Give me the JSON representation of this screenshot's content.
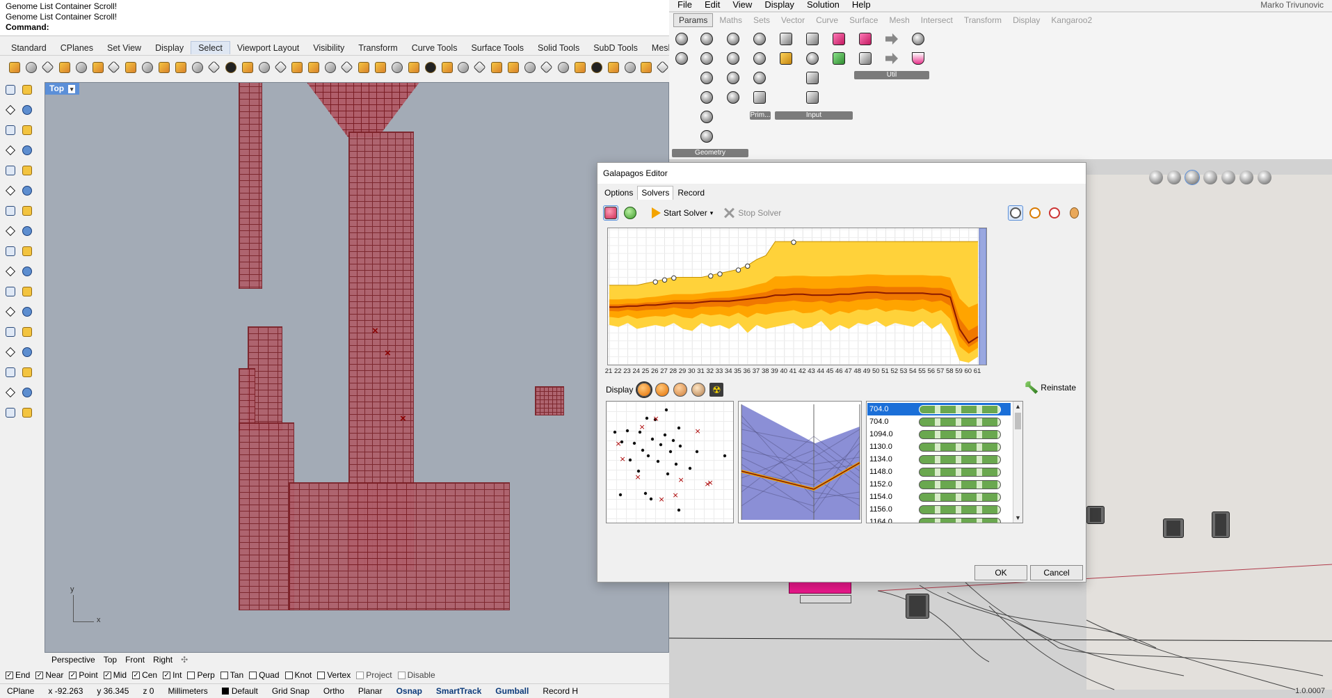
{
  "rhino": {
    "command_history": [
      "Genome List Container Scroll!",
      "Genome List Container Scroll!"
    ],
    "command_prompt": "Command:",
    "tabs": [
      "Standard",
      "CPlanes",
      "Set View",
      "Display",
      "Select",
      "Viewport Layout",
      "Visibility",
      "Transform",
      "Curve Tools",
      "Surface Tools",
      "Solid Tools",
      "SubD Tools",
      "Mesh Tools"
    ],
    "active_tab": "Select",
    "viewport_label": "Top",
    "viewport_tabs": [
      "Perspective",
      "Top",
      "Front",
      "Right"
    ],
    "axis_labels": {
      "y": "y",
      "x": "x"
    },
    "osnaps": [
      {
        "label": "End",
        "checked": true
      },
      {
        "label": "Near",
        "checked": true
      },
      {
        "label": "Point",
        "checked": true
      },
      {
        "label": "Mid",
        "checked": true
      },
      {
        "label": "Cen",
        "checked": true
      },
      {
        "label": "Int",
        "checked": true
      },
      {
        "label": "Perp",
        "checked": false
      },
      {
        "label": "Tan",
        "checked": false
      },
      {
        "label": "Quad",
        "checked": false
      },
      {
        "label": "Knot",
        "checked": false
      },
      {
        "label": "Vertex",
        "checked": false
      },
      {
        "label": "Project",
        "checked": false
      },
      {
        "label": "Disable",
        "checked": false
      }
    ],
    "status": {
      "cplane": "CPlane",
      "x": "x -92.263",
      "y": "y 36.345",
      "z": "z 0",
      "units": "Millimeters",
      "layer": "Default",
      "grid_snap": "Grid Snap",
      "ortho": "Ortho",
      "planar": "Planar",
      "osnap": "Osnap",
      "smarttrack": "SmartTrack",
      "gumball": "Gumball",
      "record": "Record H"
    }
  },
  "grasshopper": {
    "menu": [
      "File",
      "Edit",
      "View",
      "Display",
      "Solution",
      "Help"
    ],
    "user": "Marko Trivunovic",
    "tabs": [
      "Params",
      "Maths",
      "Sets",
      "Vector",
      "Curve",
      "Surface",
      "Mesh",
      "Intersect",
      "Transform",
      "Display",
      "Kangaroo2"
    ],
    "active_tab": "Params",
    "groups": [
      "Geometry",
      "Prim...",
      "Input",
      "Util"
    ],
    "zoom": "1.0.0007"
  },
  "galapagos": {
    "title": "Galapagos Editor",
    "tabs": [
      "Options",
      "Solvers",
      "Record"
    ],
    "active_tab": "Solvers",
    "start_solver": "Start Solver",
    "stop_solver": "Stop Solver",
    "display_label": "Display",
    "reinstate": "Reinstate",
    "ok": "OK",
    "cancel": "Cancel",
    "genomes": [
      "704.0",
      "704.0",
      "1094.0",
      "1130.0",
      "1134.0",
      "1148.0",
      "1152.0",
      "1154.0",
      "1156.0",
      "1164.0"
    ],
    "selected_genome": 0,
    "colors": {
      "band_outer": "#ffd23a",
      "band_mid": "#ffa400",
      "band_inner": "#f07800",
      "mean_line": "#8a1a00",
      "selected_row": "#1b6fd8"
    }
  },
  "chart_data": {
    "type": "area",
    "title": "",
    "xlabel": "",
    "ylabel": "",
    "x": [
      21,
      22,
      23,
      24,
      25,
      26,
      27,
      28,
      29,
      30,
      31,
      32,
      33,
      34,
      35,
      36,
      37,
      38,
      39,
      40,
      41,
      42,
      43,
      44,
      45,
      46,
      47,
      48,
      49,
      50,
      51,
      52,
      53,
      54,
      55,
      56,
      57,
      58,
      59,
      60,
      61
    ],
    "series": [
      {
        "values": [
          40,
          40,
          40,
          40,
          41,
          42,
          43,
          44,
          44,
          44,
          44,
          45,
          46,
          47,
          48,
          50,
          53,
          55,
          62,
          62,
          62,
          62,
          62,
          62,
          62,
          62,
          62,
          62,
          62,
          62,
          62,
          62,
          62,
          62,
          62,
          62,
          62,
          62,
          62,
          62,
          62
        ]
      },
      {
        "values": [
          29,
          29,
          29.5,
          29.5,
          30,
          30,
          30.5,
          31,
          31,
          31,
          31.5,
          32,
          32,
          32,
          32.5,
          33,
          33.5,
          34,
          35,
          35,
          35.5,
          35.5,
          35,
          35,
          35,
          35.5,
          35.5,
          36,
          36.5,
          36.5,
          36,
          36,
          36,
          36,
          36,
          35.5,
          35.5,
          34,
          18,
          11,
          14
        ]
      },
      {
        "values": [
          20,
          19,
          21,
          18,
          19,
          20,
          19,
          21,
          18,
          17,
          21,
          19,
          20,
          18,
          21,
          16,
          20,
          18,
          19,
          20,
          21,
          18,
          19,
          22,
          17,
          20,
          18,
          21,
          20,
          22,
          19,
          21,
          20,
          19,
          22,
          18,
          21,
          14,
          2,
          1,
          4
        ]
      }
    ],
    "milestones": [
      26,
      27,
      28,
      32,
      33,
      35,
      36,
      41
    ],
    "ylim": [
      0,
      68
    ]
  }
}
